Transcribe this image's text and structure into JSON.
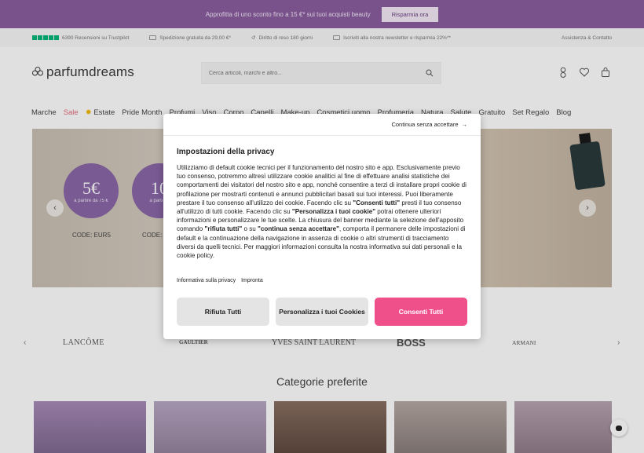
{
  "promo": {
    "text": "Approfitta di uno sconto fino a 15 €* sui tuoi acquisti beauty",
    "button": "Risparmia ora"
  },
  "info_bar": {
    "reviews": "6390 Recensioni su Trustpilot",
    "shipping": "Spedizione gratuita da 29,00 €*",
    "returns": "Diritto di reso 180 giorni",
    "newsletter": "Iscriviti alla nostra newsletter e risparmia 22%**",
    "assistance": "Assistenza & Contatto"
  },
  "header": {
    "logo": "parfumdreams",
    "search_placeholder": "Cerca articoli, marchi e altro..."
  },
  "nav": [
    "Marche",
    "Sale",
    "Estate",
    "Pride Month",
    "Profumi",
    "Viso",
    "Corpo",
    "Capelli",
    "Make-up",
    "Cosmetici uomo",
    "Profumeria",
    "Natura",
    "Salute",
    "Gratuito",
    "Set Regalo",
    "Blog"
  ],
  "hero": {
    "coupon1_amount": "5€",
    "coupon1_sub": "a partire da 75 €",
    "coupon1_code": "CODE: EUR5",
    "coupon2_amount": "10",
    "coupon2_sub": "a parti 79",
    "coupon2_code": "CODE:"
  },
  "brands": [
    "LANCÔME",
    "GAULTIER",
    "YVES SAINT LAURENT",
    "BOSS",
    "ARMANI"
  ],
  "categories_title": "Categorie preferite",
  "modal": {
    "continue_link": "Continua senza accettare",
    "title": "Impostazioni della privacy",
    "body": [
      {
        "t": "Utilizziamo di default cookie tecnici per il funzionamento del nostro sito e app. Esclusivamente previo tuo consenso, potremmo altresì utilizzare cookie analitici al fine di effettuare analisi statistiche dei comportamenti dei visitatori del nostro sito e app, nonché consentire a terzi di installare propri cookie di profilazione per mostrarti contenuti e annunci pubblicitari basati sui tuoi interessi. Puoi liberamente prestare il tuo consenso all'utilizzo dei cookie. Facendo clic su ",
        "b": false
      },
      {
        "t": "\"Consenti tutti\"",
        "b": true
      },
      {
        "t": " presti il tuo consenso all'utilizzo di tutti cookie. Facendo clic su ",
        "b": false
      },
      {
        "t": "\"Personalizza i tuoi cookie\"",
        "b": true
      },
      {
        "t": " potrai ottenere ulteriori informazioni e personalizzare le tue scelte. La chiusura del banner mediante la selezione dell'apposito comando ",
        "b": false
      },
      {
        "t": "\"rifiuta tutti\"",
        "b": true
      },
      {
        "t": " o su ",
        "b": false
      },
      {
        "t": "\"continua senza accettare\"",
        "b": true
      },
      {
        "t": ", comporta il permanere delle impostazioni di default e la continuazione della navigazione in assenza di cookie o altri strumenti di tracciamento diversi da quelli tecnici. Per maggiori informazioni consulta la nostra informativa sui dati personali e la cookie policy.",
        "b": false
      }
    ],
    "link_privacy": "Informativa sulla privacy",
    "link_imprint": "Impronta",
    "btn_reject": "Rifiuta Tutti",
    "btn_customize": "Personalizza i tuoi Cookies",
    "btn_accept": "Consenti Tutti"
  },
  "colors": {
    "promo_bg": "#8a5ea0",
    "accept_btn": "#f0508a",
    "trustpilot_green": "#00b67a",
    "sale_text": "#e06c7a"
  }
}
